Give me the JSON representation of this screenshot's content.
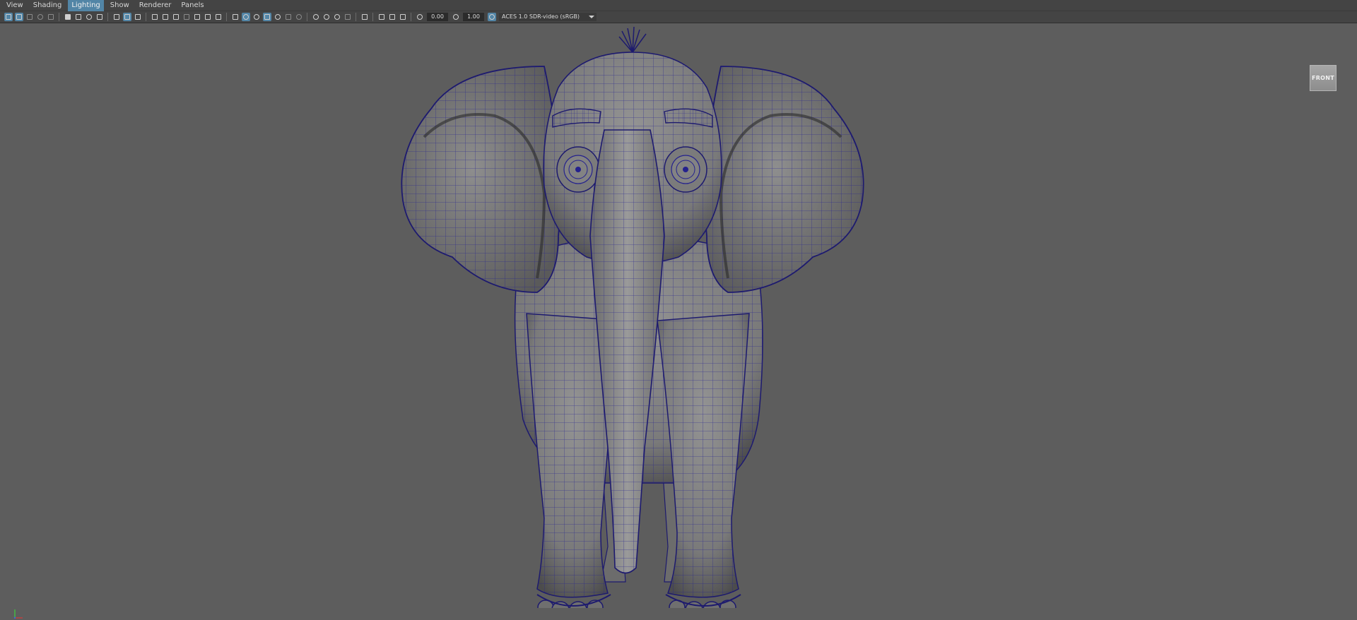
{
  "menubar": {
    "items": [
      {
        "label": "View"
      },
      {
        "label": "Shading"
      },
      {
        "label": "Lighting",
        "active": true
      },
      {
        "label": "Show"
      },
      {
        "label": "Renderer"
      },
      {
        "label": "Panels"
      }
    ]
  },
  "toolbar": {
    "exposure_value": "0.00",
    "gamma_value": "1.00",
    "color_space": "ACES 1.0 SDR-video (sRGB)",
    "icons": [
      "select-camera-icon",
      "camera-attributes-icon",
      "bookmarks-icon",
      "image-plane-icon",
      "grid-icon",
      "film-gate-icon",
      "resolution-gate-icon",
      "gate-mask-icon",
      "field-chart-icon",
      "safe-action-icon",
      "safe-title-icon",
      "wireframe-icon",
      "smooth-shade-icon",
      "wireframe-on-shaded-icon",
      "textured-icon",
      "lighting-icon",
      "shadows-icon",
      "isolate-select-icon",
      "xray-icon",
      "xray-joints-icon",
      "backface-culling-icon",
      "screen-space-ao-icon",
      "motion-blur-icon",
      "anti-aliasing-icon",
      "depth-of-field-icon",
      "exposure-icon",
      "gamma-icon",
      "color-management-icon"
    ]
  },
  "viewport": {
    "view_cube_label": "FRONT",
    "background_color": "#5d5d5d",
    "wireframe_color": "#24218e",
    "model": "elephant"
  }
}
